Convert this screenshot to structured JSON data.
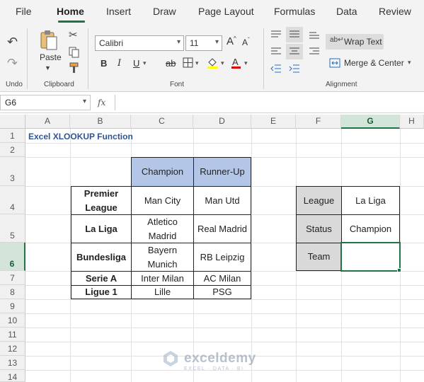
{
  "ribbon_tabs": [
    "File",
    "Home",
    "Insert",
    "Draw",
    "Page Layout",
    "Formulas",
    "Data",
    "Review"
  ],
  "active_tab": "Home",
  "groups": {
    "undo": "Undo",
    "clipboard": "Clipboard",
    "font": "Font",
    "alignment": "Alignment"
  },
  "clipboard": {
    "paste_label": "Paste"
  },
  "font": {
    "name": "Calibri",
    "size": "11",
    "bold": "B",
    "italic": "I",
    "underline": "U",
    "strike": "ab",
    "increase": "A",
    "decrease": "A"
  },
  "alignment": {
    "wrap_text": "Wrap Text",
    "merge_center": "Merge & Center"
  },
  "formula_bar": {
    "name_box": "G6",
    "fx": "fx",
    "formula": ""
  },
  "columns": [
    "A",
    "B",
    "C",
    "D",
    "E",
    "F",
    "G",
    "H"
  ],
  "selected_column": "G",
  "rows": [
    "1",
    "2",
    "3",
    "4",
    "5",
    "6",
    "7",
    "8",
    "9",
    "10",
    "11",
    "12",
    "13",
    "14"
  ],
  "selected_row": "6",
  "sheet": {
    "title": "Excel XLOOKUP Function",
    "table_headers": [
      "Champion",
      "Runner-Up"
    ],
    "table_rows": [
      {
        "league": "Premier League",
        "champion": "Man City",
        "runner_up": "Man Utd"
      },
      {
        "league": "La Liga",
        "champion": "Atletico Madrid",
        "runner_up": "Real Madrid"
      },
      {
        "league": "Bundesliga",
        "champion": "Bayern Munich",
        "runner_up": "RB Leipzig"
      },
      {
        "league": "Serie A",
        "champion": "Inter Milan",
        "runner_up": "AC Milan"
      },
      {
        "league": "Ligue 1",
        "champion": "Lille",
        "runner_up": "PSG"
      }
    ],
    "lookup": [
      {
        "label": "League",
        "value": "La Liga"
      },
      {
        "label": "Status",
        "value": "Champion"
      },
      {
        "label": "Team",
        "value": ""
      }
    ]
  },
  "watermark": {
    "name": "exceldemy",
    "tagline": "EXCEL · DATA · BI"
  },
  "colors": {
    "accent": "#217346",
    "header_blue": "#b4c6e7",
    "header_gray": "#d9d9d9",
    "title_blue": "#2f5597"
  }
}
